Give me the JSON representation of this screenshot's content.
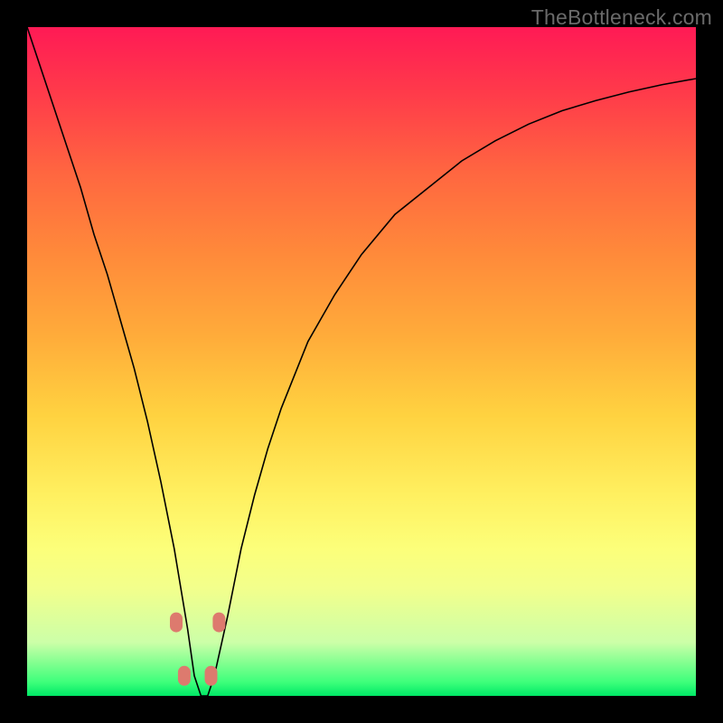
{
  "watermark": "TheBottleneck.com",
  "chart_data": {
    "type": "line",
    "title": "",
    "xlabel": "",
    "ylabel": "",
    "xlim": [
      0,
      100
    ],
    "ylim": [
      0,
      100
    ],
    "series": [
      {
        "name": "bottleneck-curve",
        "x": [
          0,
          2,
          4,
          6,
          8,
          10,
          12,
          14,
          16,
          18,
          20,
          22,
          24,
          25,
          26,
          27,
          28,
          30,
          32,
          34,
          36,
          38,
          42,
          46,
          50,
          55,
          60,
          65,
          70,
          75,
          80,
          85,
          90,
          95,
          100
        ],
        "y": [
          100,
          94,
          88,
          82,
          76,
          69,
          63,
          56,
          49,
          41,
          32,
          22,
          10,
          3,
          0,
          0,
          3,
          12,
          22,
          30,
          37,
          43,
          53,
          60,
          66,
          72,
          76,
          80,
          83,
          85.5,
          87.5,
          89,
          90.3,
          91.4,
          92.3
        ]
      }
    ],
    "markers": [
      {
        "x": 22.3,
        "y": 11,
        "label": "left-upper-marker"
      },
      {
        "x": 23.5,
        "y": 3,
        "label": "left-lower-marker"
      },
      {
        "x": 27.5,
        "y": 3,
        "label": "right-lower-marker"
      },
      {
        "x": 28.7,
        "y": 11,
        "label": "right-upper-marker"
      }
    ],
    "gradient_stops": [
      {
        "pos": 0,
        "color": "#ff1a55"
      },
      {
        "pos": 22,
        "color": "#ff6740"
      },
      {
        "pos": 46,
        "color": "#ffab3a"
      },
      {
        "pos": 70,
        "color": "#fff060"
      },
      {
        "pos": 92,
        "color": "#ccffa8"
      },
      {
        "pos": 100,
        "color": "#00e866"
      }
    ]
  }
}
